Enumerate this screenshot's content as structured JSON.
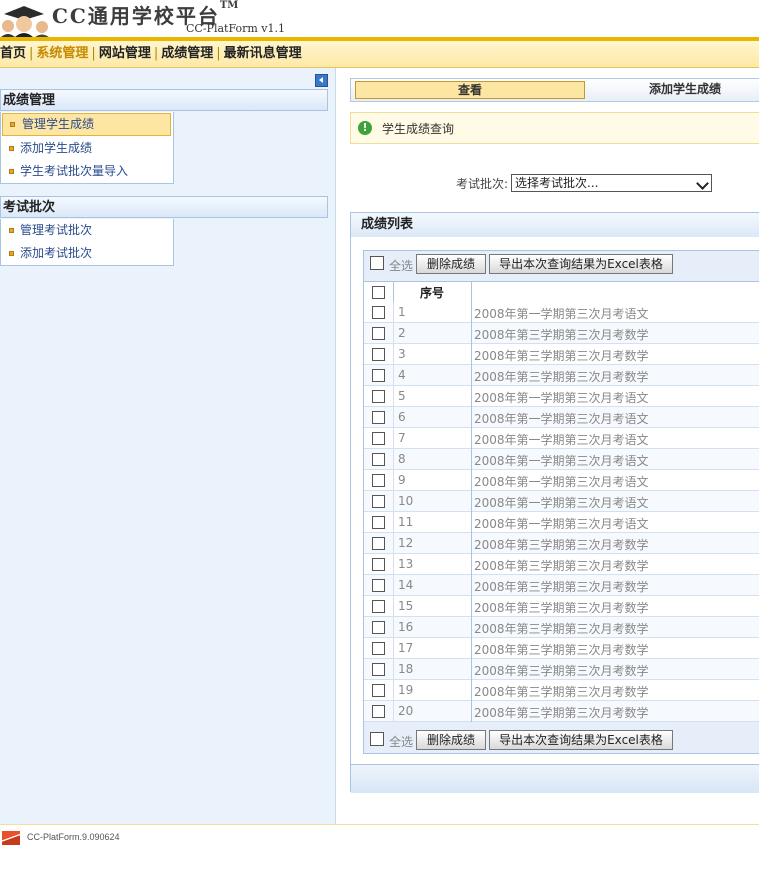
{
  "header": {
    "title": "CC通用学校平台",
    "tm": "TM",
    "subtitle": "CC-PlatForm v1.1"
  },
  "nav": {
    "items": [
      "首页",
      "系统管理",
      "网站管理",
      "成绩管理",
      "最新讯息管理"
    ],
    "active": "系统管理"
  },
  "sidebar": {
    "groups": [
      {
        "title": "成绩管理",
        "items": [
          "管理学生成绩",
          "添加学生成绩",
          "学生考试批次量导入"
        ]
      },
      {
        "title": "考试批次",
        "items": [
          "管理考试批次",
          "添加考试批次"
        ]
      }
    ],
    "selected": "管理学生成绩"
  },
  "tabs": {
    "view": "查看",
    "add": "添加学生成绩"
  },
  "notice": {
    "icon": "!",
    "text": "学生成绩查询"
  },
  "filter": {
    "label": "考试批次:",
    "selected": "选择考试批次..."
  },
  "grid": {
    "title": "成绩列表",
    "select_all": "全选",
    "delete_button": "删除成绩",
    "export_button": "导出本次查询结果为Excel表格",
    "col_number": "序号",
    "rows": [
      {
        "num": "1",
        "name": "2008年第一学期第三次月考语文"
      },
      {
        "num": "2",
        "name": "2008年第三学期第三次月考数学"
      },
      {
        "num": "3",
        "name": "2008年第三学期第三次月考数学"
      },
      {
        "num": "4",
        "name": "2008年第三学期第三次月考数学"
      },
      {
        "num": "5",
        "name": "2008年第一学期第三次月考语文"
      },
      {
        "num": "6",
        "name": "2008年第一学期第三次月考语文"
      },
      {
        "num": "7",
        "name": "2008年第一学期第三次月考语文"
      },
      {
        "num": "8",
        "name": "2008年第一学期第三次月考语文"
      },
      {
        "num": "9",
        "name": "2008年第一学期第三次月考语文"
      },
      {
        "num": "10",
        "name": "2008年第一学期第三次月考语文"
      },
      {
        "num": "11",
        "name": "2008年第一学期第三次月考语文"
      },
      {
        "num": "12",
        "name": "2008年第三学期第三次月考数学"
      },
      {
        "num": "13",
        "name": "2008年第三学期第三次月考数学"
      },
      {
        "num": "14",
        "name": "2008年第三学期第三次月考数学"
      },
      {
        "num": "15",
        "name": "2008年第三学期第三次月考数学"
      },
      {
        "num": "16",
        "name": "2008年第三学期第三次月考数学"
      },
      {
        "num": "17",
        "name": "2008年第三学期第三次月考数学"
      },
      {
        "num": "18",
        "name": "2008年第三学期第三次月考数学"
      },
      {
        "num": "19",
        "name": "2008年第三学期第三次月考数学"
      },
      {
        "num": "20",
        "name": "2008年第三学期第三次月考数学"
      }
    ]
  },
  "footer": {
    "text": "CC-PlatForm.9.090624"
  }
}
